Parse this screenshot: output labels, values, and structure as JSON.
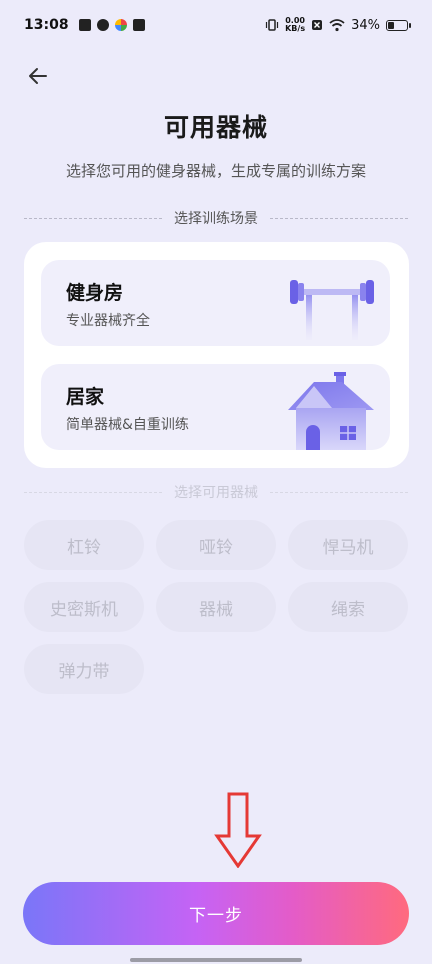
{
  "status_bar": {
    "time": "13:08",
    "netspeed_value": "0.00",
    "netspeed_unit": "KB/s",
    "battery_percent": "34%",
    "battery_level": 0.34
  },
  "header": {
    "title": "可用器械",
    "subtitle": "选择您可用的健身器械，生成专属的训练方案"
  },
  "scene_section": {
    "label": "选择训练场景",
    "options": [
      {
        "title": "健身房",
        "desc": "专业器械齐全",
        "icon": "barbell-rack-icon"
      },
      {
        "title": "居家",
        "desc": "简单器械&自重训练",
        "icon": "house-icon"
      }
    ]
  },
  "equipment_section": {
    "label": "选择可用器械",
    "chips": [
      "杠铃",
      "哑铃",
      "悍马机",
      "史密斯机",
      "器械",
      "绳索",
      "弹力带"
    ]
  },
  "footer": {
    "next_label": "下一步"
  },
  "colors": {
    "background": "#ECEBFA",
    "accent_purple": "#7A76F8",
    "accent_pink": "#FF6A7E",
    "arrow_red": "#E53935"
  }
}
